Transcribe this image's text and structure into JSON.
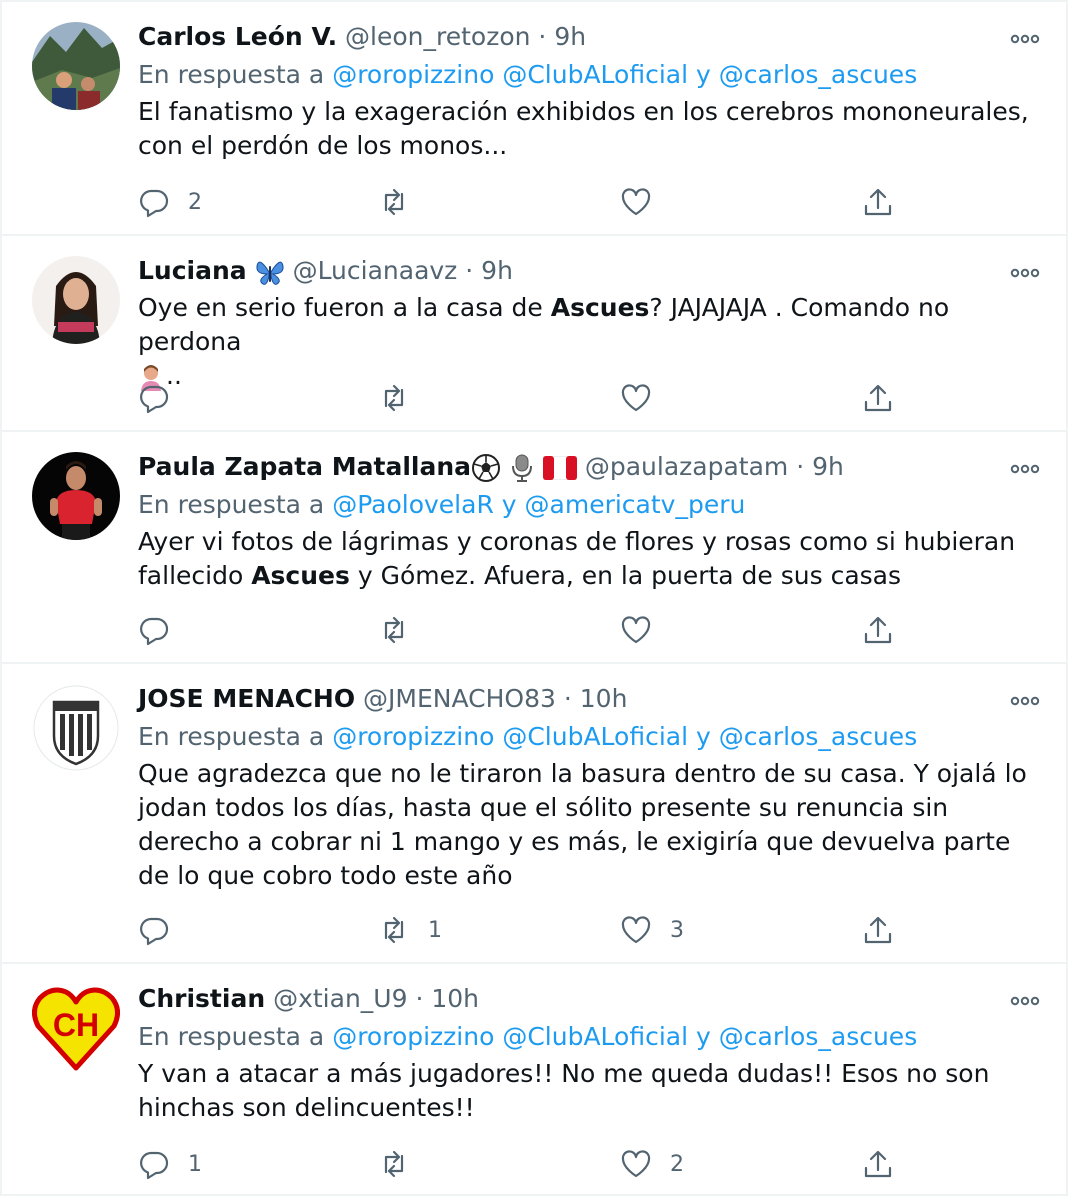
{
  "colors": {
    "text": "#0f1419",
    "secondary": "#536471",
    "link": "#1d9bf0",
    "divider": "#eff3f4"
  },
  "icons": [
    "more-icon",
    "reply-icon",
    "retweet-icon",
    "like-icon",
    "share-icon",
    "butterfly-emoji",
    "soccer-ball-emoji",
    "microphone-emoji",
    "peru-flag-emoji",
    "woman-tipping-hand-emoji"
  ],
  "tweets": [
    {
      "name": "Carlos León V.",
      "handle": "@leon_retozon",
      "dot": "·",
      "time": "9h",
      "reply_prefix": "En respuesta a",
      "mentions": [
        "@roropizzino",
        "@ClubALoficial",
        "y",
        "@carlos_ascues"
      ],
      "text": "El fanatismo y la exageración exhibidos en los cerebros mononeurales, con el perdón de los monos...",
      "replies": "2",
      "retweets": "",
      "likes": ""
    },
    {
      "name": "Luciana",
      "handle": "@Lucianaavz",
      "dot": "·",
      "time": "9h",
      "text_before": "Oye en serio fueron a la casa de ",
      "text_bold": "Ascues",
      "text_after": "? JAJAJAJA . Comando no perdona",
      "text_tail": "..",
      "replies": "",
      "retweets": "",
      "likes": ""
    },
    {
      "name": "Paula Zapata Matallana",
      "handle": "@paulazapatam",
      "dot": "·",
      "time": "9h",
      "reply_prefix": "En respuesta a",
      "mentions": [
        "@PaolovelaR",
        "y",
        "@americatv_peru"
      ],
      "text_before": "Ayer vi fotos de lágrimas y coronas de flores y rosas como si hubieran fallecido ",
      "text_bold": "Ascues",
      "text_after": " y Gómez. Afuera, en la puerta de sus casas",
      "replies": "",
      "retweets": "",
      "likes": ""
    },
    {
      "name": "JOSE MENACHO",
      "handle": "@JMENACHO83",
      "dot": "·",
      "time": "10h",
      "reply_prefix": "En respuesta a",
      "mentions": [
        "@roropizzino",
        "@ClubALoficial",
        "y",
        "@carlos_ascues"
      ],
      "text": "Que agradezca que no le tiraron la basura dentro de su casa. Y ojalá lo jodan todos los días, hasta que el sólito presente su renuncia sin derecho a cobrar ni 1 mango y es más, le exigiría que devuelva parte de lo que cobro todo este año",
      "replies": "",
      "retweets": "1",
      "likes": "3"
    },
    {
      "name": "Christian",
      "handle": "@xtian_U9",
      "dot": "·",
      "time": "10h",
      "reply_prefix": "En respuesta a",
      "mentions": [
        "@roropizzino",
        "@ClubALoficial",
        "y",
        "@carlos_ascues"
      ],
      "avatar_text": "CH",
      "text": "Y van a atacar a más jugadores!! No me queda dudas!! Esos no son hinchas son delincuentes!!",
      "replies": "1",
      "retweets": "",
      "likes": "2"
    }
  ]
}
